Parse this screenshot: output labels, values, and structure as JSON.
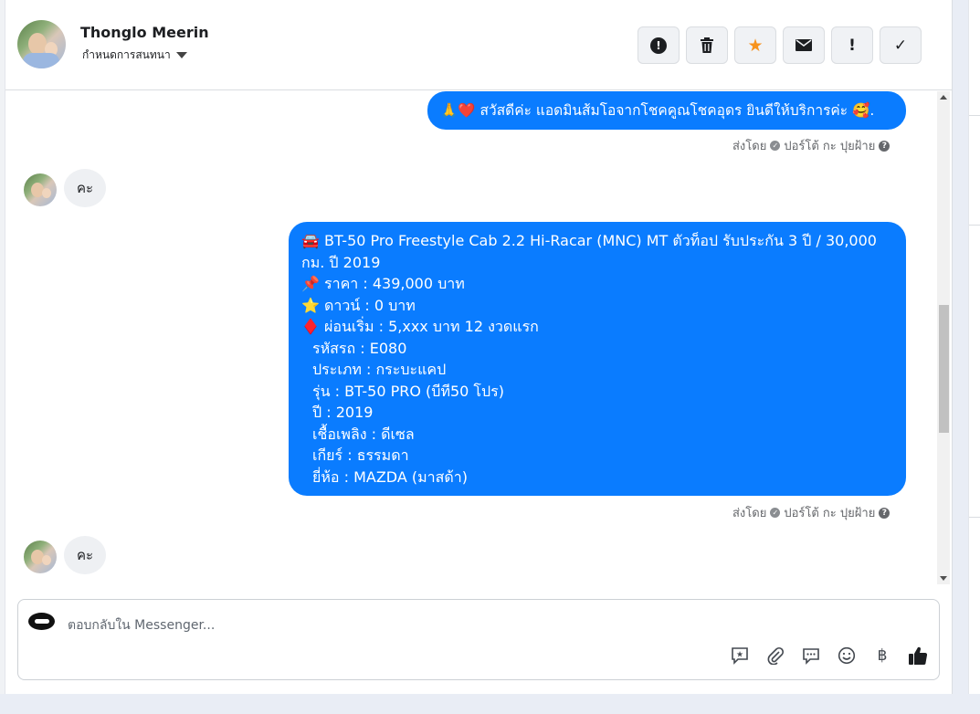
{
  "header": {
    "contact_name": "Thonglo Meerin",
    "assign_label": "กำหนดการสนทนา",
    "actions": [
      {
        "icon": "alert-circle-icon",
        "glyph": "!"
      },
      {
        "icon": "trash-icon",
        "glyph": "🗑"
      },
      {
        "icon": "star-icon",
        "glyph": "★"
      },
      {
        "icon": "envelope-icon",
        "glyph": "✉"
      },
      {
        "icon": "exclamation-icon",
        "glyph": "!"
      },
      {
        "icon": "check-icon",
        "glyph": "✓"
      }
    ]
  },
  "messages": {
    "greeting": "🙏❤️ สวัสดีค่ะ แอดมินส้มโอจากโชคคูณโชคอุดร ยินดีให้บริการค่ะ 🥰.",
    "sent_by_1": "ส่งโดย",
    "sender_1": "ปอร์โต้ กะ ปุยฝ้าย",
    "reply_1": "คะ",
    "listing_lines": [
      "🚘 BT-50 Pro Freestyle Cab 2.2 Hi-Racar (MNC) MT ตัวท็อป รับประกัน 3 ปี / 30,000",
      "กม. ปี 2019",
      "📌 ราคา : 439,000 บาท",
      "⭐ ดาวน์ : 0 บาท",
      "♦️ ผ่อนเริ่ม : 5,xxx บาท 12 งวดแรก",
      "   รหัสรถ : E080",
      "   ประเภท : กระบะแคป",
      "   รุ่น : BT-50 PRO (บีที50 โปร)",
      "   ปี : 2019",
      "   เชื้อเพลิง : ดีเซล",
      "   เกียร์ : ธรรมดา",
      "   ยี่ห้อ : MAZDA (มาสด้า)"
    ],
    "sent_by_2": "ส่งโดย",
    "sender_2": "ปอร์โต้ กะ ปุยฝ้าย",
    "reply_2": "คะ"
  },
  "composer": {
    "placeholder": "ตอบกลับใน Messenger...",
    "tools": [
      {
        "icon": "saved-reply-icon",
        "glyph": "✪"
      },
      {
        "icon": "paperclip-icon",
        "glyph": "📎"
      },
      {
        "icon": "chat-bubble-icon",
        "glyph": "💬"
      },
      {
        "icon": "emoji-icon",
        "glyph": "☺"
      },
      {
        "icon": "baht-icon",
        "glyph": "฿"
      },
      {
        "icon": "thumbs-up-icon",
        "glyph": "👍"
      }
    ]
  },
  "colors": {
    "outgoing_bubble": "#0a7cff",
    "incoming_bubble": "#eef0f3",
    "star_accent": "#f7931e"
  }
}
